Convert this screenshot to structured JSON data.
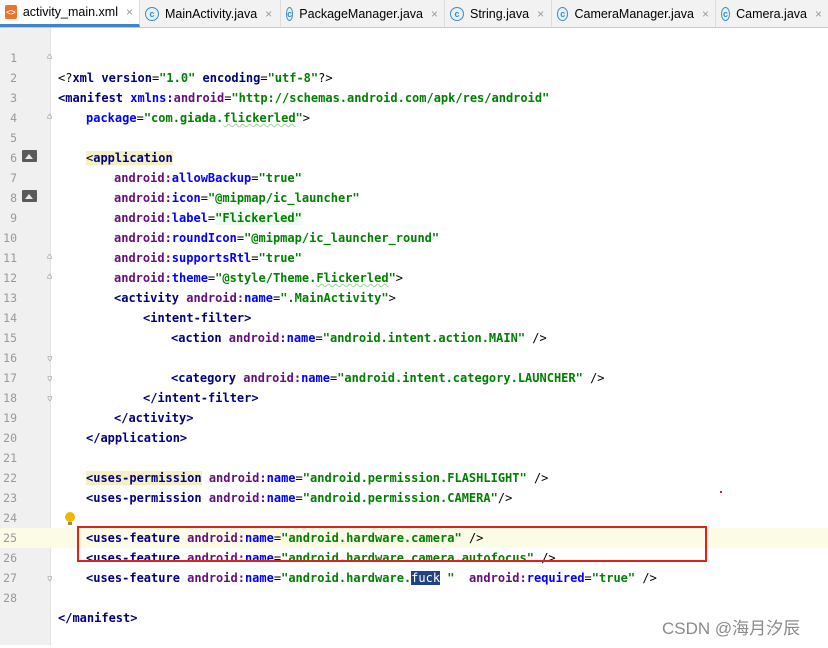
{
  "tabs": [
    {
      "label": "activity_main.xml",
      "icon": "xml-file-icon",
      "active": true
    },
    {
      "label": "MainActivity.java",
      "icon": "class-icon",
      "active": false
    },
    {
      "label": "PackageManager.java",
      "icon": "class-icon",
      "active": false
    },
    {
      "label": "String.java",
      "icon": "class-icon",
      "active": false
    },
    {
      "label": "CameraManager.java",
      "icon": "class-icon",
      "active": false
    },
    {
      "label": "Camera.java",
      "icon": "class-icon",
      "active": false
    }
  ],
  "tab_close_glyph": "×",
  "line_numbers": [
    "1",
    "2",
    "3",
    "4",
    "5",
    "6",
    "7",
    "8",
    "9",
    "10",
    "11",
    "12",
    "13",
    "14",
    "15",
    "16",
    "17",
    "18",
    "19",
    "20",
    "21",
    "22",
    "23",
    "24",
    "25",
    "26",
    "27",
    "28"
  ],
  "code": {
    "l1": {
      "a": "<?",
      "b": "xml version",
      "c": "=",
      "d": "\"1.0\"",
      "e": " encoding",
      "f": "=",
      "g": "\"utf-8\"",
      "h": "?>"
    },
    "l2": {
      "a": "<manifest",
      "b": " xmlns:",
      "c": "android",
      "d": "=",
      "e": "\"http://schemas.android.com/apk/res/android\""
    },
    "l3": {
      "a": "package",
      "b": "=",
      "c": "\"com.giada.",
      "d": "flickerled",
      "e": "\"",
      "f": ">"
    },
    "l5": {
      "a": "<",
      "b": "application"
    },
    "l6": {
      "a": "android:",
      "b": "allowBackup",
      "c": "=",
      "d": "\"true\""
    },
    "l7": {
      "a": "android:",
      "b": "icon",
      "c": "=",
      "d": "\"@mipmap/ic_launcher\""
    },
    "l8": {
      "a": "android:",
      "b": "label",
      "c": "=",
      "d": "\"Flickerled\""
    },
    "l9": {
      "a": "android:",
      "b": "roundIcon",
      "c": "=",
      "d": "\"@mipmap/ic_launcher_round\""
    },
    "l10": {
      "a": "android:",
      "b": "supportsRtl",
      "c": "=",
      "d": "\"true\""
    },
    "l11": {
      "a": "android:",
      "b": "theme",
      "c": "=",
      "d": "\"@style/Theme.",
      "e": "Flickerled",
      "f": "\"",
      "g": ">"
    },
    "l12": {
      "a": "<activity",
      "b": " android:",
      "c": "name",
      "d": "=",
      "e": "\".MainActivity\"",
      "f": ">"
    },
    "l13": {
      "a": "<intent-filter>"
    },
    "l14": {
      "a": "<action",
      "b": " android:",
      "c": "name",
      "d": "=",
      "e": "\"android.intent.action.MAIN\"",
      "f": " />"
    },
    "l16": {
      "a": "<category",
      "b": " android:",
      "c": "name",
      "d": "=",
      "e": "\"android.intent.category.LAUNCHER\"",
      "f": " />"
    },
    "l17": {
      "a": "</intent-filter>"
    },
    "l18": {
      "a": "</activity>"
    },
    "l19": {
      "a": "</application>"
    },
    "l21": {
      "a": "<uses-permission",
      "b": " android:",
      "c": "name",
      "d": "=",
      "e": "\"android.permission.FLASHLIGHT\"",
      "f": " />"
    },
    "l22": {
      "a": "<uses-permission",
      "b": " android:",
      "c": "name",
      "d": "=",
      "e": "\"android.permission.CAMERA\"",
      "f": "/>"
    },
    "l24": {
      "a": "<uses-feature",
      "b": " android:",
      "c": "name",
      "d": "=",
      "e": "\"android.hardware.camera\"",
      "f": " />"
    },
    "l25": {
      "a": "<uses-feature",
      "b": " android:",
      "c": "name",
      "d": "=",
      "e": "\"android.hardware.camera.autofocus\"",
      "f": " />"
    },
    "l26": {
      "a": "<uses-feature",
      "b": " android:",
      "c": "name",
      "d": "=",
      "e": "\"android.hardware.",
      "sel": "fuck",
      "f": " \"",
      "g": "  android:",
      "h": "required",
      "i": "=",
      "j": "\"true\"",
      "k": " />"
    },
    "l28": {
      "a": "</manifest>"
    }
  },
  "watermark": "CSDN @海月汐辰",
  "colors": {
    "tag": "#000080",
    "attribute": "#660e7a",
    "value": "#008000",
    "selection": "#214283",
    "annotation_box": "#e0221f"
  }
}
